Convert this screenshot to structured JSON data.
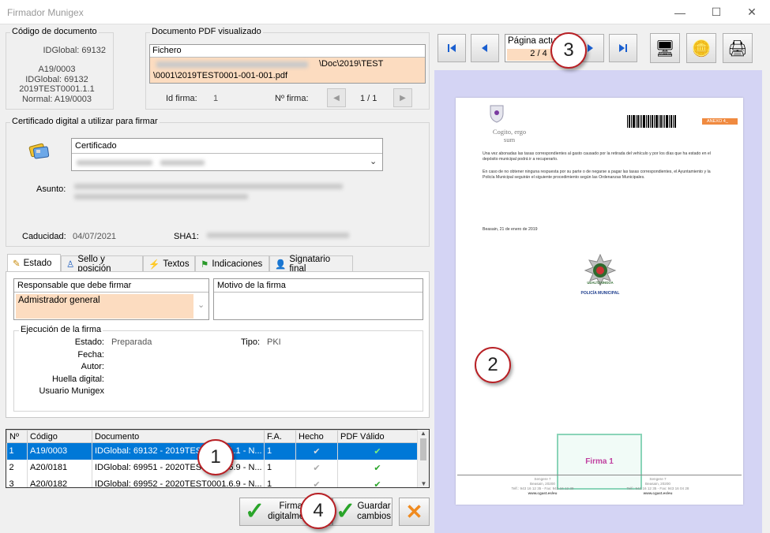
{
  "window": {
    "title": "Firmador Munigex"
  },
  "codigo": {
    "legend": "Código de documento",
    "idglobal_line": "IDGlobal: 69132",
    "lines": [
      "A19/0003",
      "IDGlobal: 69132",
      "2019TEST0001.1.1",
      "Normal: A19/0003"
    ]
  },
  "pdf": {
    "legend": "Documento PDF visualizado",
    "fichero_label": "Fichero",
    "path_part1": "\\Doc\\2019\\TEST",
    "path_part2": "\\0001\\2019TEST0001-001-001.pdf",
    "idfirma_label": "Id firma:",
    "idfirma_value": "1",
    "nfirma_label": "Nº firma:",
    "nfirma_value": "1 / 1"
  },
  "cert": {
    "legend": "Certificado digital a utilizar para firmar",
    "certificado_label": "Certificado",
    "asunto_label": "Asunto:",
    "caducidad_label": "Caducidad:",
    "caducidad_value": "04/07/2021",
    "sha1_label": "SHA1:"
  },
  "tabs": [
    {
      "label": "Estado",
      "icon": "pen-icon"
    },
    {
      "label": "Sello y posición",
      "icon": "person-icon"
    },
    {
      "label": "Textos",
      "icon": "lightning-icon"
    },
    {
      "label": "Indicaciones",
      "icon": "flag-icon"
    },
    {
      "label": "Signatario final",
      "icon": "user-icon"
    }
  ],
  "estado": {
    "responsable_label": "Responsable que debe firmar",
    "responsable_value": "Admistrador general",
    "motivo_label": "Motivo de la firma",
    "ejecucion_legend": "Ejecución de la firma",
    "estado_label": "Estado:",
    "estado_value": "Preparada",
    "tipo_label": "Tipo:",
    "tipo_value": "PKI",
    "fecha_label": "Fecha:",
    "autor_label": "Autor:",
    "huella_label": "Huella digital:",
    "usuario_label": "Usuario Munigex"
  },
  "table": {
    "headers": [
      "Nº",
      "Código",
      "Documento",
      "F.A.",
      "Hecho",
      "PDF Válido"
    ],
    "rows": [
      {
        "n": "1",
        "codigo": "A19/0003",
        "documento": "IDGlobal: 69132 - 2019TEST0001.1.1 - N...",
        "fa": "1"
      },
      {
        "n": "2",
        "codigo": "A20/0181",
        "documento": "IDGlobal: 69951 - 2020TEST0001.6.9 - N...",
        "fa": "1"
      },
      {
        "n": "3",
        "codigo": "A20/0182",
        "documento": "IDGlobal: 69952 - 2020TEST0001.6.9 - N...",
        "fa": "1"
      }
    ]
  },
  "buttons": {
    "firmar_line1": "Firmar",
    "firmar_line2": "digitalmente",
    "guardar_line1": "Guardar",
    "guardar_line2": "cambios"
  },
  "pager": {
    "label": "Página actual",
    "value": "2 / 4"
  },
  "preview": {
    "logo_line1": "Cogito, ergo",
    "logo_line2": "sum",
    "anexo": "ANEXO 4_",
    "para1": "Una vez abonadas las tasas correspondientes al gasto causado por la retirada del vehículo y por los días que ha estado en el depósito municipal podrá ir a recuperarlo.",
    "para2": "En caso de no obtener ninguna respuesta por su parte o de negarse a pagar las tasas correspondientes, el Ayuntamiento y la Policía Municipal seguirán el siguiente procedimiento según las Ordenanzas Municipales.",
    "date": "Beasain, 21 de enero de 2019",
    "seal_text": "UDALTZAINGOA",
    "policia": "POLICÍA MUNICIPAL",
    "firma": "Firma 1",
    "footer_left": [
      "Sengere 7",
      "Beasain, 20200",
      "Telf.: 943 16 12 35 - Fax: 943 16 12 39"
    ],
    "footer_right": [
      "Sengere 7",
      "Beasain, 20200",
      "Telf.: 943 16 12 35 - Fax: 943 16 04 28"
    ],
    "web": "www.cgast.es/eu"
  },
  "callouts": [
    "1",
    "2",
    "3",
    "4"
  ]
}
